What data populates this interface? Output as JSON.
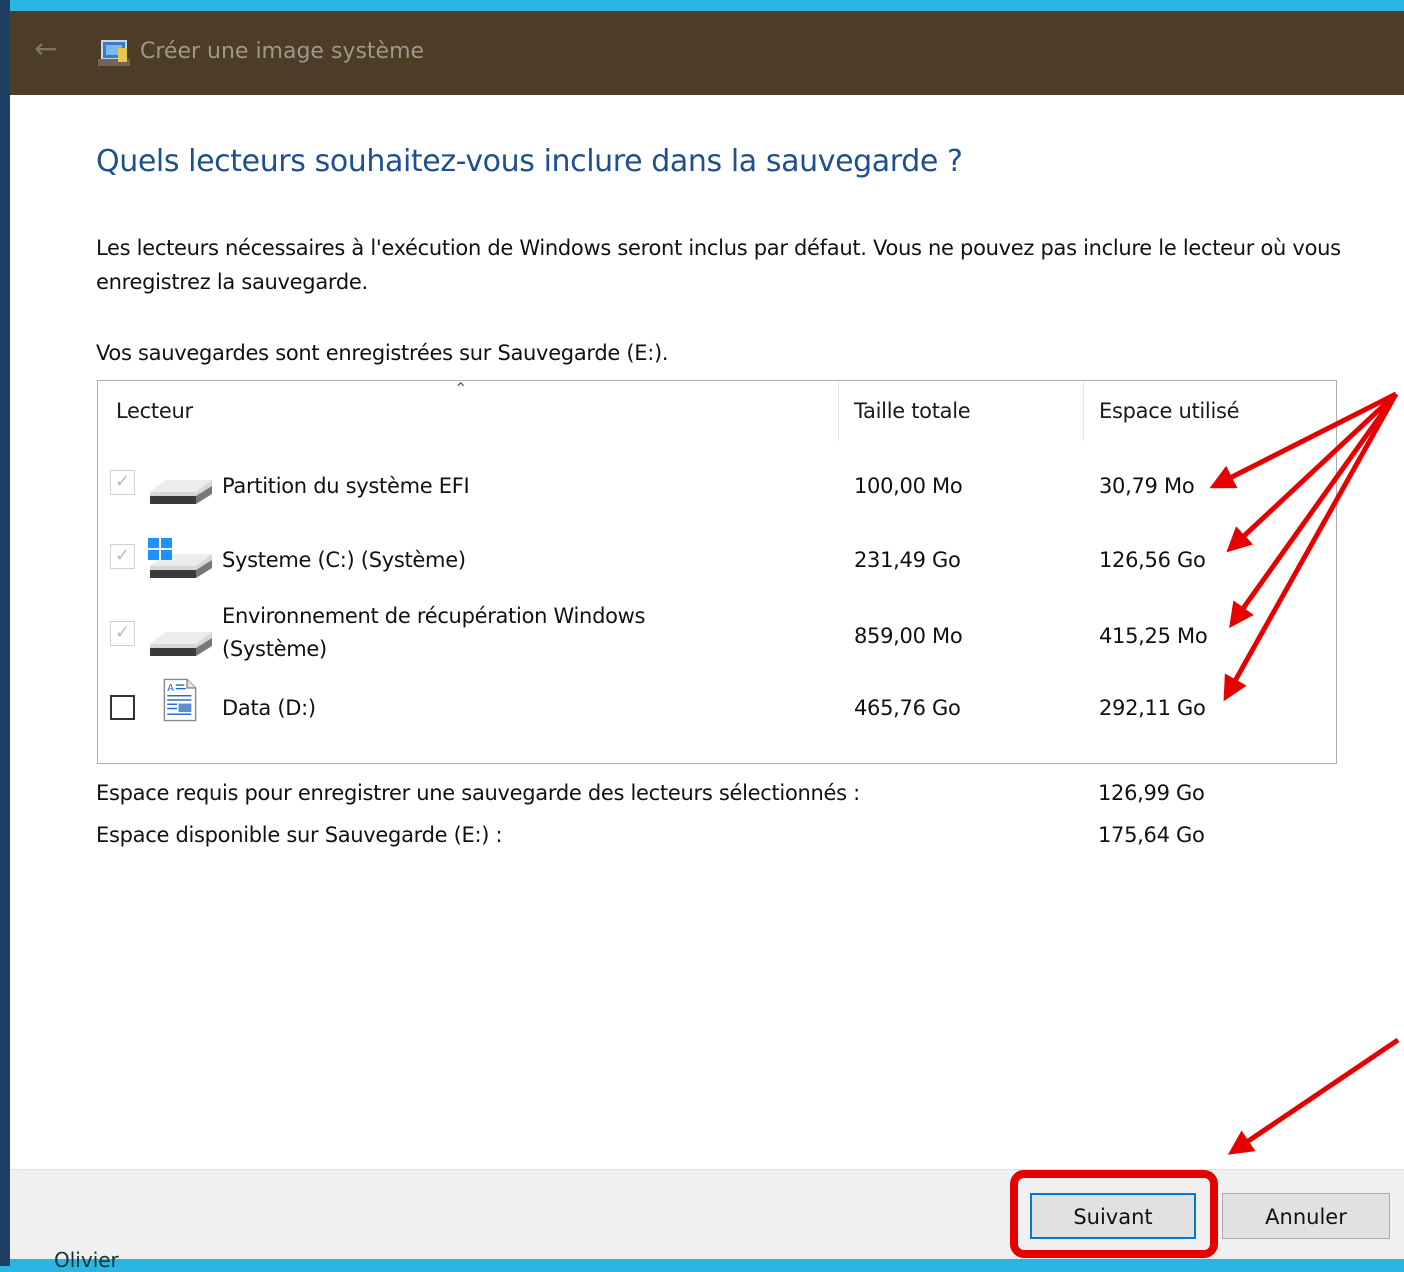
{
  "window": {
    "title": "Créer une image système"
  },
  "page": {
    "heading": "Quels lecteurs souhaitez-vous inclure dans la sauvegarde ?",
    "description": "Les lecteurs nécessaires à l'exécution de Windows seront inclus par défaut. Vous ne pouvez pas inclure le lecteur où vous enregistrez la sauvegarde.",
    "saved_to": "Vos sauvegardes sont enregistrées sur Sauvegarde (E:)."
  },
  "drive_table": {
    "columns": [
      "Lecteur",
      "Taille totale",
      "Espace utilisé"
    ],
    "rows": [
      {
        "name": "Partition du système EFI",
        "total": "100,00 Mo",
        "used": "30,79 Mo",
        "checked": true,
        "disabled": true,
        "icon": "drive-icon"
      },
      {
        "name": "Systeme (C:) (Système)",
        "total": "231,49 Go",
        "used": "126,56 Go",
        "checked": true,
        "disabled": true,
        "icon": "windows-drive-icon"
      },
      {
        "name": "Environnement de récupération Windows (Système)",
        "total": "859,00 Mo",
        "used": "415,25 Mo",
        "checked": true,
        "disabled": true,
        "icon": "drive-icon"
      },
      {
        "name": "Data (D:)",
        "total": "465,76 Go",
        "used": "292,11 Go",
        "checked": false,
        "disabled": false,
        "icon": "document-icon"
      }
    ]
  },
  "summary": {
    "required_label": "Espace requis pour enregistrer une sauvegarde des lecteurs sélectionnés :",
    "required_value": "126,99 Go",
    "available_label": "Espace disponible sur Sauvegarde (E:) :",
    "available_value": "175,64 Go"
  },
  "buttons": {
    "next": "Suivant",
    "cancel": "Annuler"
  },
  "user": "Olivier",
  "colors": {
    "heading": "#1d4f91",
    "titlebar": "#4d3c26",
    "annotation": "#e60000",
    "desktop": "#2bb5e3"
  }
}
